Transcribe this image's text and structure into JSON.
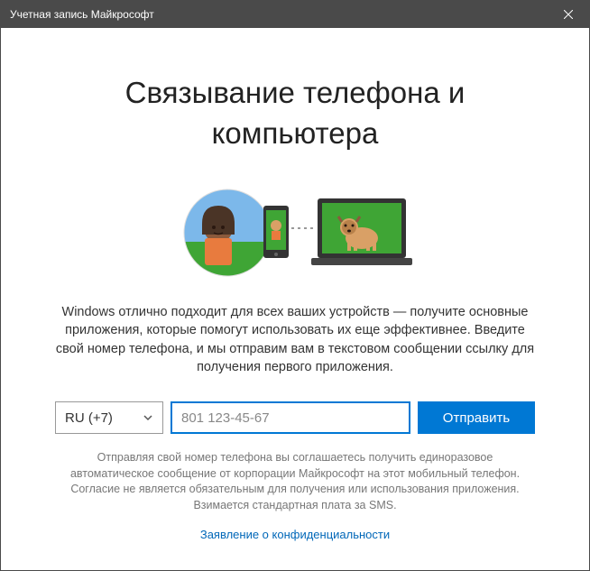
{
  "titlebar": {
    "title": "Учетная запись Майкрософт"
  },
  "main": {
    "heading": "Связывание телефона и компьютера",
    "description": "Windows отлично подходит для всех ваших устройств — получите основные приложения, которые помогут использовать их еще эффективнее. Введите свой номер телефона, и мы отправим вам в текстовом сообщении ссылку для получения первого приложения."
  },
  "form": {
    "country_code": "RU (+7)",
    "phone_placeholder": "801 123-45-67",
    "phone_value": "",
    "submit_label": "Отправить"
  },
  "footer": {
    "disclaimer": "Отправляя свой номер телефона вы соглашаетесь получить единоразовое автоматическое сообщение от корпорации Майкрософт на этот мобильный телефон. Согласие не является обязательным для получения или использования приложения. Взимается стандартная плата за SMS.",
    "privacy_link": "Заявление о конфиденциальности"
  },
  "colors": {
    "accent": "#0078d4",
    "titlebar_bg": "#4a4a4a"
  }
}
